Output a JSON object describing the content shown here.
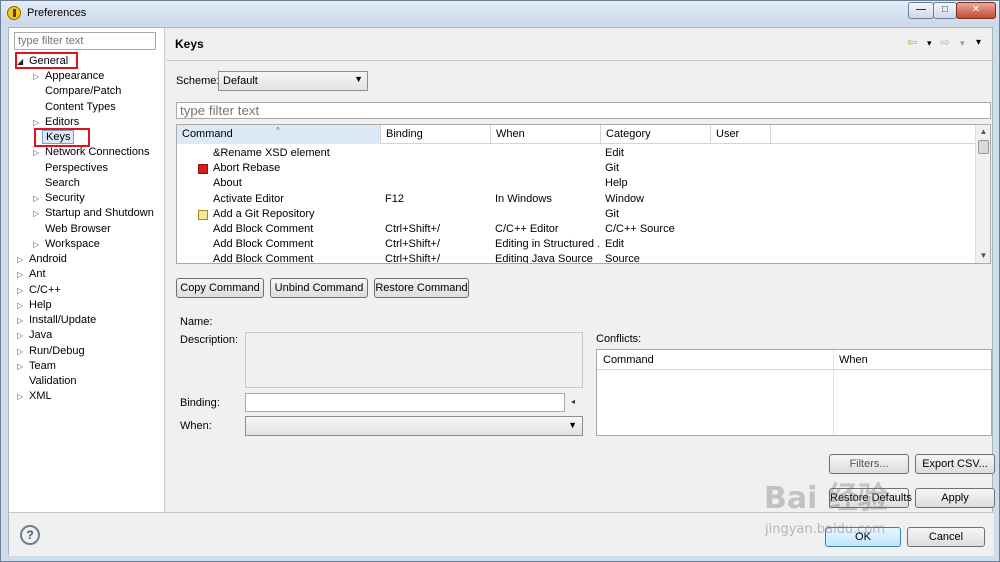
{
  "window": {
    "title": "Preferences",
    "minimize_glyph": "—",
    "maximize_glyph": "□",
    "close_glyph": "✕"
  },
  "sidebar": {
    "filter_placeholder": "type filter text",
    "items": [
      {
        "label": "General",
        "expander": "◢"
      },
      {
        "label": "Appearance",
        "expander": "▷"
      },
      {
        "label": "Compare/Patch",
        "expander": ""
      },
      {
        "label": "Content Types",
        "expander": ""
      },
      {
        "label": "Editors",
        "expander": "▷"
      },
      {
        "label": "Keys",
        "expander": ""
      },
      {
        "label": "Network Connections",
        "expander": "▷"
      },
      {
        "label": "Perspectives",
        "expander": ""
      },
      {
        "label": "Search",
        "expander": ""
      },
      {
        "label": "Security",
        "expander": "▷"
      },
      {
        "label": "Startup and Shutdown",
        "expander": "▷"
      },
      {
        "label": "Web Browser",
        "expander": ""
      },
      {
        "label": "Workspace",
        "expander": "▷"
      },
      {
        "label": "Android",
        "expander": "▷"
      },
      {
        "label": "Ant",
        "expander": "▷"
      },
      {
        "label": "C/C++",
        "expander": "▷"
      },
      {
        "label": "Help",
        "expander": "▷"
      },
      {
        "label": "Install/Update",
        "expander": "▷"
      },
      {
        "label": "Java",
        "expander": "▷"
      },
      {
        "label": "Run/Debug",
        "expander": "▷"
      },
      {
        "label": "Team",
        "expander": "▷"
      },
      {
        "label": "Validation",
        "expander": ""
      },
      {
        "label": "XML",
        "expander": "▷"
      }
    ]
  },
  "page": {
    "title": "Keys",
    "nav_back": "⇦",
    "nav_forward": "⇨",
    "nav_menu": "▾",
    "scheme_label": "Scheme:",
    "scheme_value": "Default",
    "filter_placeholder": "type filter text",
    "table": {
      "columns": [
        "Command",
        "Binding",
        "When",
        "Category",
        "User"
      ],
      "sort_glyph": "^",
      "rows": [
        {
          "command": "&Rename XSD element",
          "binding": "",
          "when": "",
          "category": "Edit",
          "icon": ""
        },
        {
          "command": "Abort Rebase",
          "binding": "",
          "when": "",
          "category": "Git",
          "icon": "red"
        },
        {
          "command": "About",
          "binding": "",
          "when": "",
          "category": "Help",
          "icon": ""
        },
        {
          "command": "Activate Editor",
          "binding": "F12",
          "when": "In Windows",
          "category": "Window",
          "icon": ""
        },
        {
          "command": "Add a Git Repository",
          "binding": "",
          "when": "",
          "category": "Git",
          "icon": "git"
        },
        {
          "command": "Add Block Comment",
          "binding": "Ctrl+Shift+/",
          "when": "C/C++ Editor",
          "category": "C/C++ Source",
          "icon": ""
        },
        {
          "command": "Add Block Comment",
          "binding": "Ctrl+Shift+/",
          "when": "Editing in Structured ...",
          "category": "Edit",
          "icon": ""
        },
        {
          "command": "Add Block Comment",
          "binding": "Ctrl+Shift+/",
          "when": "Editing Java Source",
          "category": "Source",
          "icon": ""
        }
      ]
    },
    "buttons": {
      "copy": "Copy Command",
      "unbind": "Unbind Command",
      "restore": "Restore Command"
    },
    "details": {
      "name_label": "Name:",
      "description_label": "Description:",
      "binding_label": "Binding:",
      "when_label": "When:",
      "conflicts_label": "Conflicts:",
      "conflicts_columns": [
        "Command",
        "When"
      ]
    },
    "filters_button": "Filters...",
    "export_button": "Export CSV...",
    "restore_defaults_button": "Restore Defaults",
    "apply_button": "Apply"
  },
  "footer": {
    "help_glyph": "?",
    "ok_button": "OK",
    "cancel_button": "Cancel"
  },
  "watermark": {
    "brand": "Bai  经验",
    "url": "jingyan.baidu.com"
  },
  "colors": {
    "highlight": "#e0141e",
    "selection": "#dceaf8"
  }
}
